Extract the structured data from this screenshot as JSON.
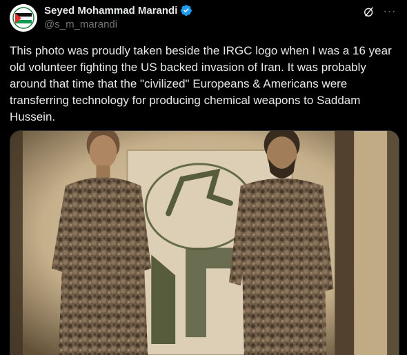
{
  "post": {
    "author": {
      "display_name": "Seyed Mohammad Marandi",
      "handle": "@s_m_marandi",
      "avatar_icon": "palestine-flag-avatar",
      "verified": true,
      "verified_color": "#1d9bf0"
    },
    "body": "This photo was proudly taken beside the IRGC logo when I was a 16 year\nold volunteer fighting the US backed invasion of Iran. It was probably\naround that time that the \"civilized\" Europeans & Americans were\ntransferring technology for producing chemical weapons to Saddam\nHussein.",
    "actions": {
      "grok_icon": "grok-icon",
      "more_icon": "more-icon",
      "more_label": "···"
    },
    "media": {
      "kind": "photo",
      "description_icon": "sepia-photo-two-soldiers-irgc-logo"
    }
  },
  "colors": {
    "background": "#000000",
    "text": "#e7e9ea",
    "secondary_text": "#71767b",
    "accent": "#1d9bf0"
  }
}
